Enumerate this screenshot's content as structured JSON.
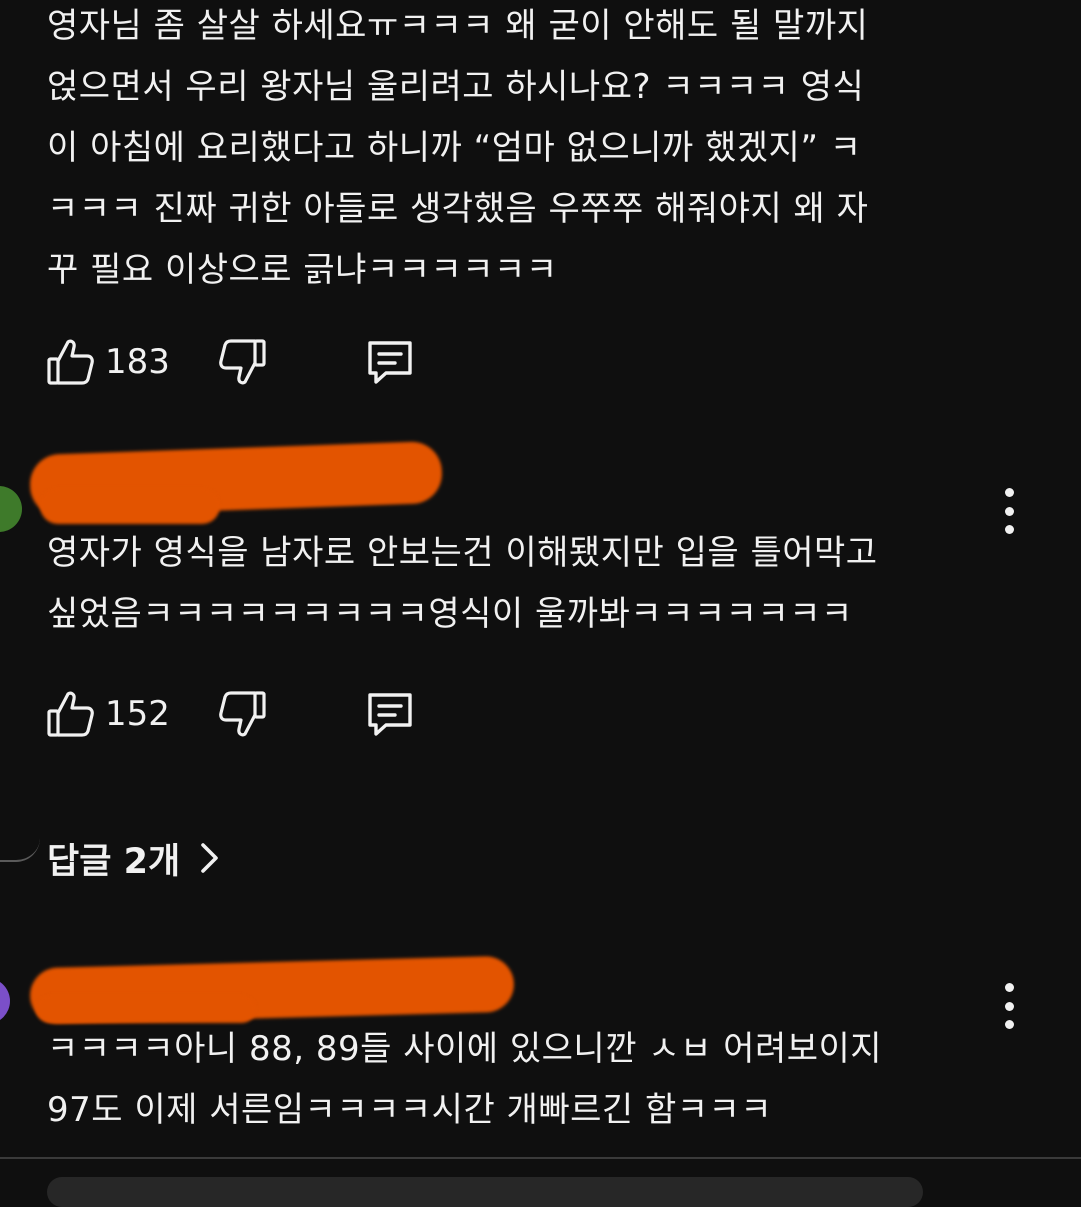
{
  "comments": [
    {
      "text": "영자님 좀 살살 하세요ㅠㅋㅋㅋ 왜 굳이 안해도 될 말까지\n얹으면서 우리 왕자님 울리려고 하시나요? ㅋㅋㅋㅋ 영식\n이 아침에 요리했다고 하니까 “엄마 없으니까 했겠지” ㅋ\nㅋㅋㅋ 진짜 귀한 아들로 생각했음 우쭈쭈 해줘야지 왜 자\n꾸 필요 이상으로 긁냐ㅋㅋㅋㅋㅋㅋ",
      "likes": "183"
    },
    {
      "text": "영자가 영식을 남자로 안보는건 이해됐지만 입을 틀어막고\n싶었음ㅋㅋㅋㅋㅋㅋㅋㅋㅋ영식이 울까봐ㅋㅋㅋㅋㅋㅋㅋ",
      "likes": "152",
      "replies_label": "답글 2개",
      "avatar_color": "#3e7a2a"
    },
    {
      "text": "ㅋㅋㅋㅋ아니 88, 89들 사이에 있으니깐 ㅅㅂ 어려보이지\n97도 이제 서른임ㅋㅋㅋㅋ시간 개빠르긴 함ㅋㅋㅋ",
      "avatar_color": "#7b4fc9"
    }
  ],
  "colors": {
    "background": "#0f0f0f",
    "text": "#f1f1f1",
    "redaction": "#e35400"
  },
  "icons": [
    "thumbs-up-icon",
    "thumbs-down-icon",
    "reply-icon",
    "more-vert-icon",
    "chevron-right-icon"
  ]
}
